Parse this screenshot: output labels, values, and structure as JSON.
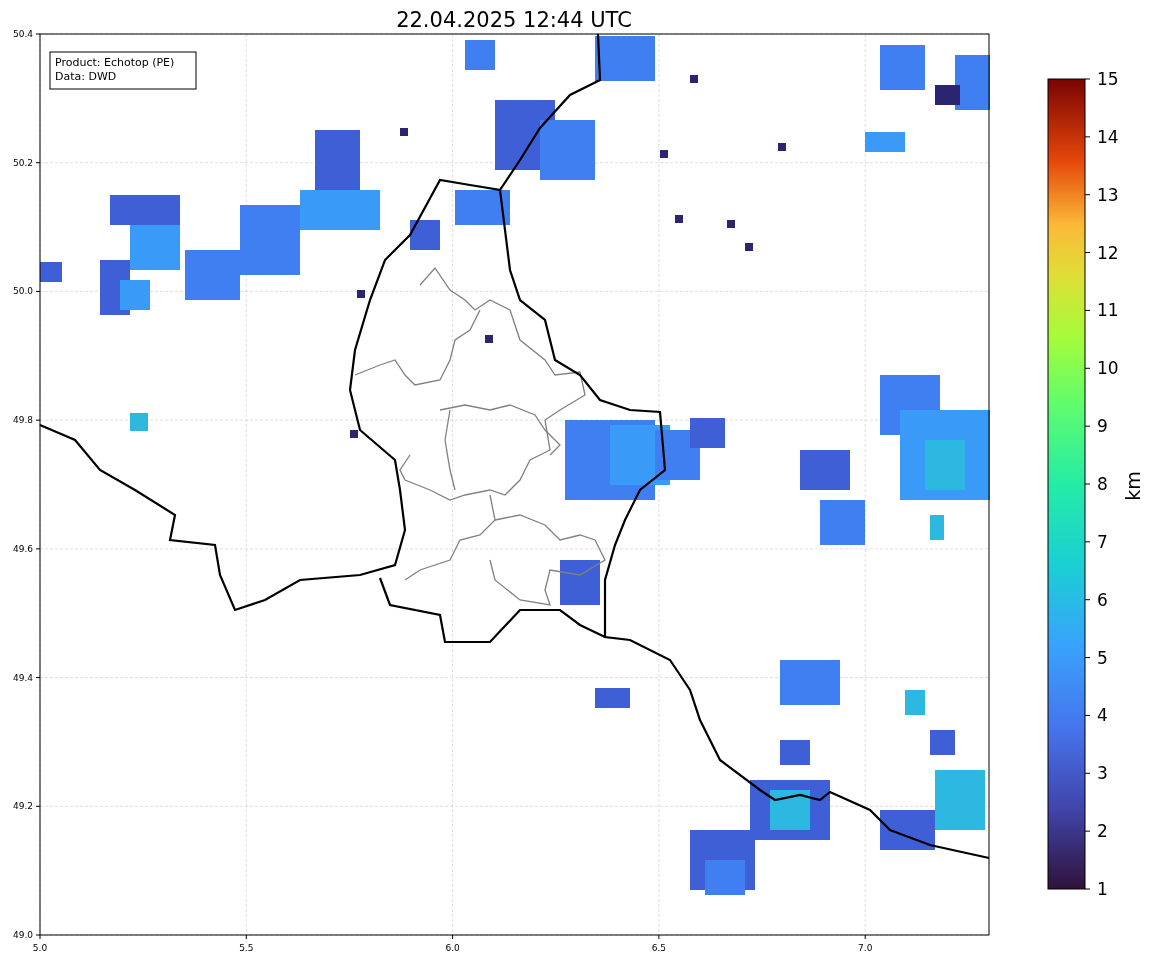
{
  "title": "22.04.2025 12:44 UTC",
  "map": {
    "info_box": [
      "Product: Echotop (PE)",
      "Data: DWD"
    ],
    "xticks": [
      "5.0",
      "5.5",
      "6.0",
      "6.5",
      "7.0"
    ],
    "yticks": [
      "50.4",
      "50.2",
      "50.0",
      "49.8",
      "49.6",
      "49.4",
      "49.2",
      "49.0"
    ]
  },
  "colorbar": {
    "label": "km",
    "ticks": [
      "15",
      "14",
      "13",
      "12",
      "11",
      "10",
      "9",
      "8",
      "7",
      "6",
      "5",
      "4",
      "3",
      "2",
      "1"
    ]
  }
}
